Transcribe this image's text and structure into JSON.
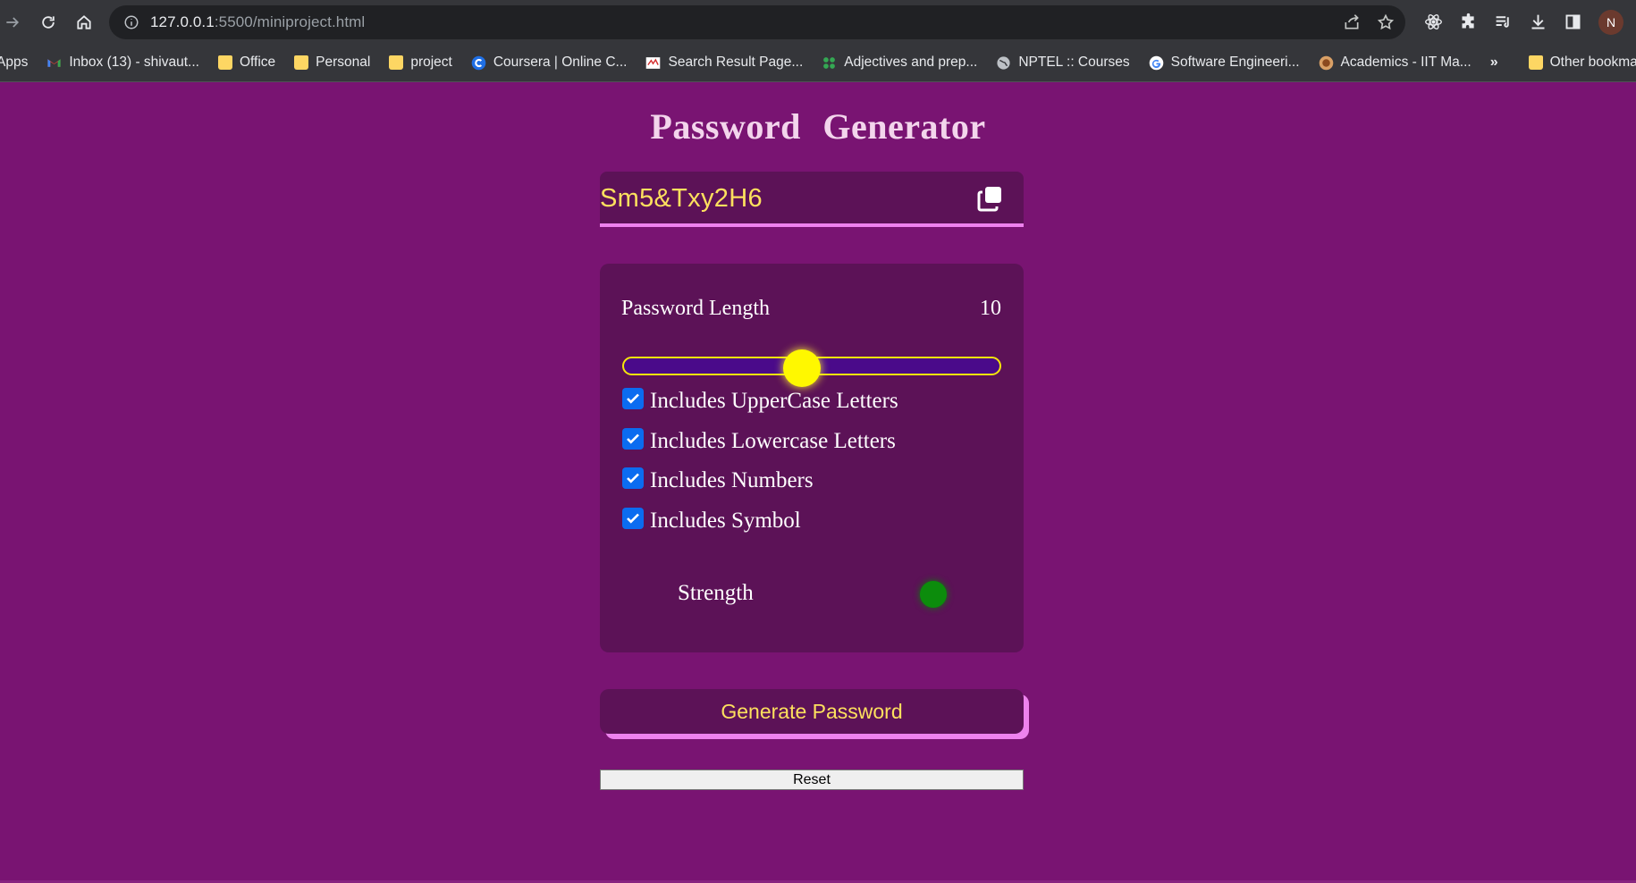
{
  "browser": {
    "url_host": "127.0.0.1",
    "url_rest": ":5500/miniproject.html",
    "profile_initial": "N"
  },
  "bookmarks": {
    "items": [
      {
        "label": "Apps"
      },
      {
        "label": "Inbox (13) - shivaut..."
      },
      {
        "label": "Office"
      },
      {
        "label": "Personal"
      },
      {
        "label": "project"
      },
      {
        "label": "Coursera | Online C..."
      },
      {
        "label": "Search Result Page..."
      },
      {
        "label": "Adjectives and prep..."
      },
      {
        "label": "NPTEL :: Courses"
      },
      {
        "label": "Software Engineeri..."
      },
      {
        "label": "Academics - IIT Ma..."
      }
    ],
    "overflow": "»",
    "other": "Other bookma"
  },
  "page": {
    "title": "Password  Generator",
    "password": "Sm5&Txy2H6",
    "length_label": "Password Length",
    "length_value": "10",
    "slider_fraction": 0.47,
    "options": [
      {
        "label": "Includes UpperCase Letters",
        "checked": true
      },
      {
        "label": "Includes Lowercase Letters",
        "checked": true
      },
      {
        "label": "Includes Numbers",
        "checked": true
      },
      {
        "label": "Includes Symbol",
        "checked": true
      }
    ],
    "strength_label": "Strength",
    "strength_color": "#0c8c0c",
    "generate_label": "Generate Password",
    "reset_label": "Reset"
  },
  "colors": {
    "background": "#791472",
    "panel": "#5c1257",
    "accent": "#ee82ee",
    "password_text": "#fde05e",
    "slider_thumb": "#fff800",
    "checkbox": "#0b6cf0"
  }
}
